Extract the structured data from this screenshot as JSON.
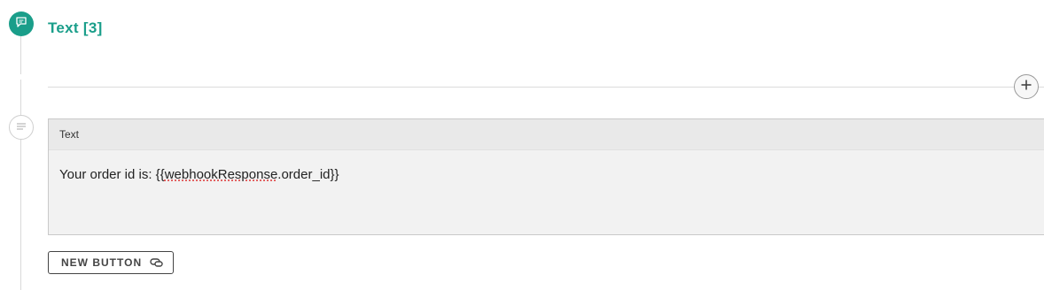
{
  "header": {
    "title": "Text [3]"
  },
  "card": {
    "header_label": "Text",
    "message_prefix": "Your order id is: {{",
    "message_var": "webhookResponse",
    "message_suffix": ".order_id}}"
  },
  "new_button": {
    "label": "NEW BUTTON"
  },
  "icons": {
    "step_node": "chat-bubble-icon",
    "sub_node": "text-lines-icon",
    "add": "plus-icon",
    "button_icon": "link-icon"
  },
  "colors": {
    "accent": "#1a9e8a"
  }
}
